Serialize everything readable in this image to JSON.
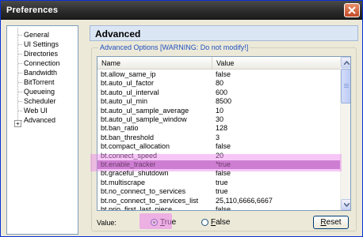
{
  "window": {
    "title": "Preferences"
  },
  "sidebar": {
    "items": [
      {
        "label": "General"
      },
      {
        "label": "UI Settings"
      },
      {
        "label": "Directories"
      },
      {
        "label": "Connection"
      },
      {
        "label": "Bandwidth"
      },
      {
        "label": "BitTorrent"
      },
      {
        "label": "Queueing"
      },
      {
        "label": "Scheduler"
      },
      {
        "label": "Web UI"
      },
      {
        "label": "Advanced"
      }
    ],
    "expander": "+"
  },
  "main": {
    "header_title": "Advanced",
    "group_title": "Advanced Options [WARNING: Do not modify!]",
    "columns": {
      "name": "Name",
      "value": "Value"
    },
    "rows": [
      {
        "name": "bt.allow_same_ip",
        "value": "false"
      },
      {
        "name": "bt.auto_ul_factor",
        "value": "80"
      },
      {
        "name": "bt.auto_ul_interval",
        "value": "600"
      },
      {
        "name": "bt.auto_ul_min",
        "value": "8500"
      },
      {
        "name": "bt.auto_ul_sample_average",
        "value": "10"
      },
      {
        "name": "bt.auto_ul_sample_window",
        "value": "30"
      },
      {
        "name": "bt.ban_ratio",
        "value": "128"
      },
      {
        "name": "bt.ban_threshold",
        "value": "3"
      },
      {
        "name": "bt.compact_allocation",
        "value": "false"
      },
      {
        "name": "bt.connect_speed",
        "value": "20"
      },
      {
        "name": "bt.enable_tracker",
        "value": "*true"
      },
      {
        "name": "bt.graceful_shutdown",
        "value": "false"
      },
      {
        "name": "bt.multiscrape",
        "value": "true"
      },
      {
        "name": "bt.no_connect_to_services",
        "value": "true"
      },
      {
        "name": "bt.no_connect_to_services_list",
        "value": "25,110,6666,6667"
      },
      {
        "name": "bt.prio_first_last_piece",
        "value": "false"
      }
    ],
    "selected_row": 10,
    "value_label": "Value:",
    "radio_true": {
      "accel": "T",
      "rest": "rue"
    },
    "radio_false": {
      "accel": "F",
      "rest": "alse"
    },
    "reset": {
      "accel": "R",
      "rest": "eset"
    }
  },
  "colors": {
    "selection": "#b77bbd",
    "highlight": "#ec82ec",
    "group_title": "#1f4fc0"
  }
}
